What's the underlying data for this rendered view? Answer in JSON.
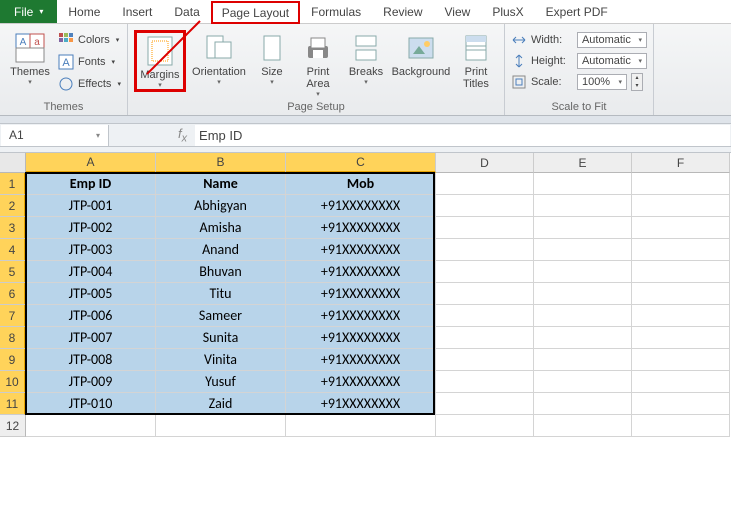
{
  "tabs": {
    "file": "File",
    "home": "Home",
    "insert": "Insert",
    "data": "Data",
    "page_layout": "Page Layout",
    "formulas": "Formulas",
    "review": "Review",
    "view": "View",
    "plusx": "PlusX",
    "expert_pdf": "Expert PDF"
  },
  "groups": {
    "themes": {
      "label": "Themes",
      "themes": "Themes",
      "colors": "Colors",
      "fonts": "Fonts",
      "effects": "Effects"
    },
    "page_setup": {
      "label": "Page Setup",
      "margins": "Margins",
      "orientation": "Orientation",
      "size": "Size",
      "print_area": "Print\nArea",
      "breaks": "Breaks",
      "background": "Background",
      "print_titles": "Print\nTitles"
    },
    "scale_to_fit": {
      "label": "Scale to Fit",
      "width": "Width:",
      "width_val": "Automatic",
      "height": "Height:",
      "height_val": "Automatic",
      "scale": "Scale:",
      "scale_val": "100%"
    }
  },
  "namebox": "A1",
  "formula": "Emp ID",
  "columns": [
    "A",
    "B",
    "C",
    "D",
    "E",
    "F"
  ],
  "headers": [
    "Emp ID",
    "Name",
    "Mob"
  ],
  "rows": [
    {
      "n": 1,
      "id": "Emp ID",
      "name": "Name",
      "mob": "Mob",
      "is_header": true
    },
    {
      "n": 2,
      "id": "JTP-001",
      "name": "Abhigyan",
      "mob": "+91XXXXXXXX"
    },
    {
      "n": 3,
      "id": "JTP-002",
      "name": "Amisha",
      "mob": "+91XXXXXXXX"
    },
    {
      "n": 4,
      "id": "JTP-003",
      "name": "Anand",
      "mob": "+91XXXXXXXX"
    },
    {
      "n": 5,
      "id": "JTP-004",
      "name": "Bhuvan",
      "mob": "+91XXXXXXXX"
    },
    {
      "n": 6,
      "id": "JTP-005",
      "name": "Titu",
      "mob": "+91XXXXXXXX"
    },
    {
      "n": 7,
      "id": "JTP-006",
      "name": "Sameer",
      "mob": "+91XXXXXXXX"
    },
    {
      "n": 8,
      "id": "JTP-007",
      "name": "Sunita",
      "mob": "+91XXXXXXXX"
    },
    {
      "n": 9,
      "id": "JTP-008",
      "name": "Vinita",
      "mob": "+91XXXXXXXX"
    },
    {
      "n": 10,
      "id": "JTP-009",
      "name": "Yusuf",
      "mob": "+91XXXXXXXX"
    },
    {
      "n": 11,
      "id": "JTP-010",
      "name": "Zaid",
      "mob": "+91XXXXXXXX"
    },
    {
      "n": 12,
      "empty": true
    }
  ]
}
